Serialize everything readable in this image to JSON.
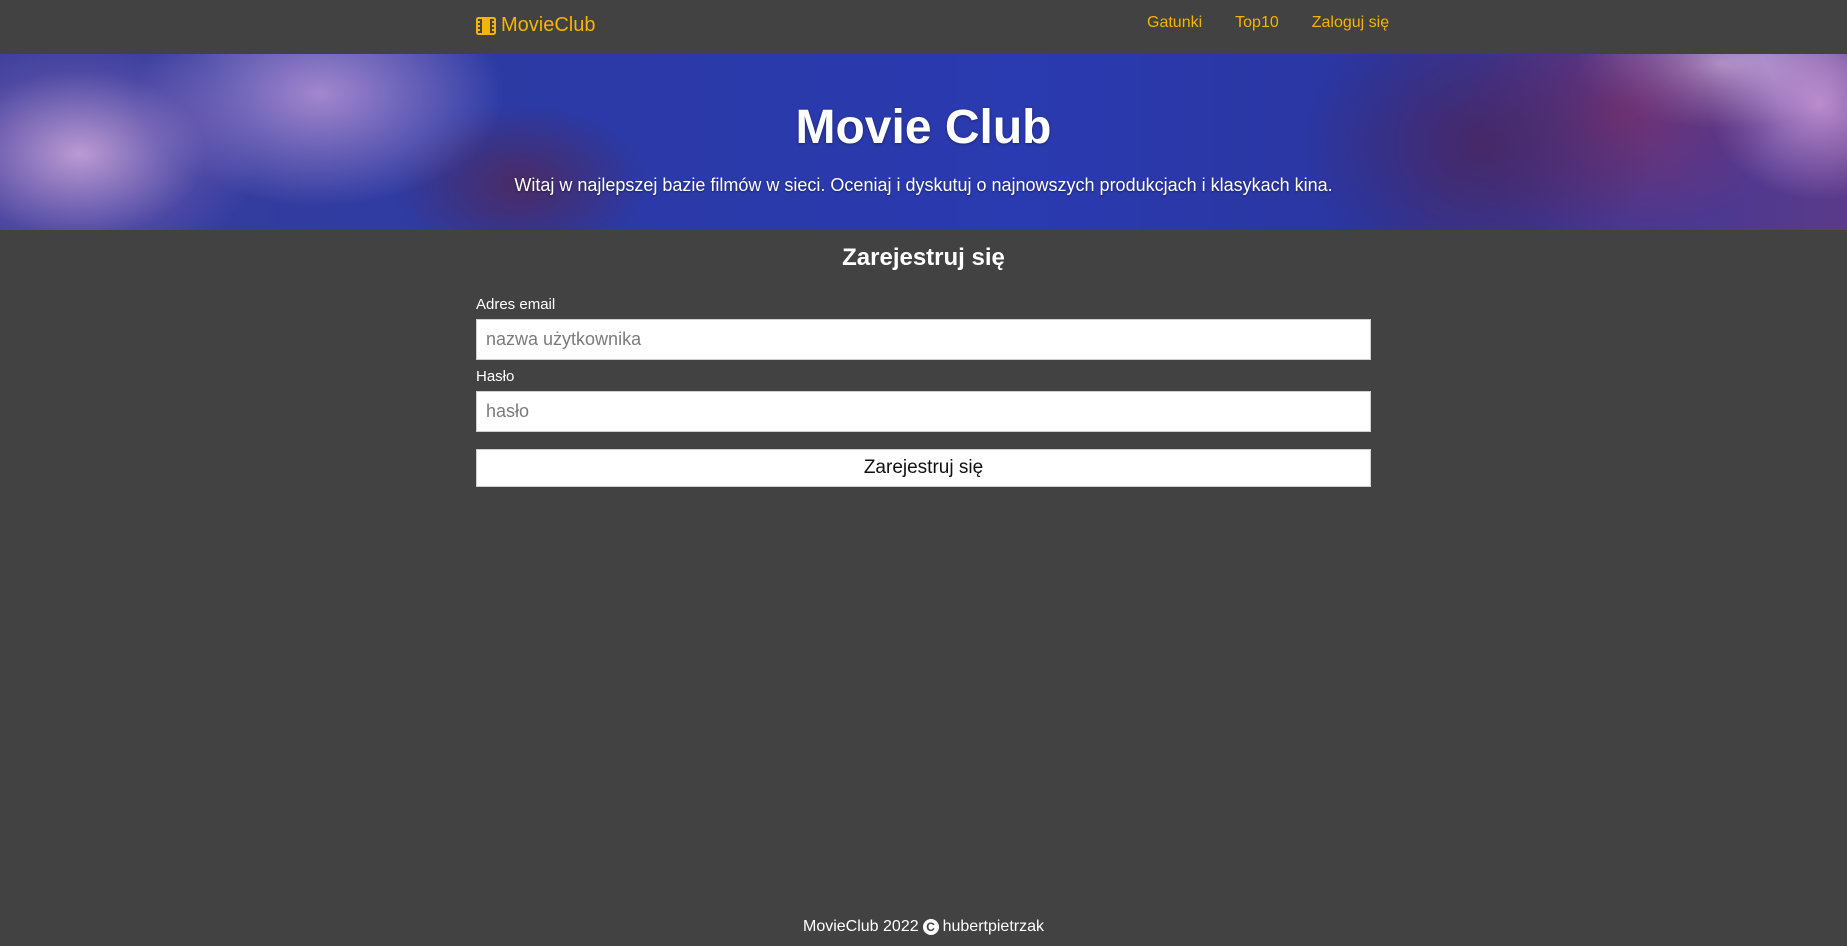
{
  "navbar": {
    "brand": "MovieClub",
    "brand_icon": "film-icon",
    "links": [
      {
        "label": "Gatunki"
      },
      {
        "label": "Top10"
      },
      {
        "label": "Zaloguj się"
      }
    ]
  },
  "hero": {
    "title": "Movie Club",
    "subtitle": "Witaj w najlepszej bazie filmów w sieci. Oceniaj i dyskutuj o najnowszych produkcjach i klasykach kina."
  },
  "register": {
    "title": "Zarejestruj się",
    "email_label": "Adres email",
    "email_placeholder": "nazwa użytkownika",
    "email_value": "",
    "password_label": "Hasło",
    "password_placeholder": "hasło",
    "password_value": "",
    "submit_label": "Zarejestruj się"
  },
  "footer": {
    "left_text": "MovieClub 2022",
    "copyright_icon": "copyright-icon",
    "right_text": "hubertpietrzak"
  },
  "colors": {
    "background": "#424242",
    "accent": "#f4b400",
    "text": "#ffffff"
  }
}
